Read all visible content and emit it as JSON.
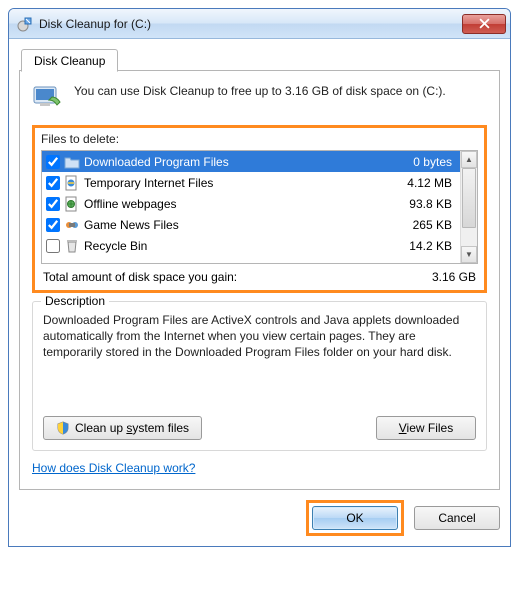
{
  "window": {
    "title": "Disk Cleanup for  (C:)"
  },
  "tab": {
    "label": "Disk Cleanup"
  },
  "intro": "You can use Disk Cleanup to free up to 3.16 GB of disk space on  (C:).",
  "files_label": "Files to delete:",
  "rows": [
    {
      "checked": true,
      "name": "Downloaded Program Files",
      "size": "0 bytes",
      "icon": "folder-download"
    },
    {
      "checked": true,
      "name": "Temporary Internet Files",
      "size": "4.12 MB",
      "icon": "ie-file"
    },
    {
      "checked": true,
      "name": "Offline webpages",
      "size": "93.8 KB",
      "icon": "globe-doc"
    },
    {
      "checked": true,
      "name": "Game News Files",
      "size": "265 KB",
      "icon": "game"
    },
    {
      "checked": false,
      "name": "Recycle Bin",
      "size": "14.2 KB",
      "icon": "recycle"
    }
  ],
  "total": {
    "label": "Total amount of disk space you gain:",
    "value": "3.16 GB"
  },
  "description": {
    "legend": "Description",
    "text": "Downloaded Program Files are ActiveX controls and Java applets downloaded automatically from the Internet when you view certain pages. They are temporarily stored in the Downloaded Program Files folder on your hard disk."
  },
  "buttons": {
    "cleanup_system": "Clean up system files",
    "view_files": "View Files",
    "ok": "OK",
    "cancel": "Cancel"
  },
  "help_link": "How does Disk Cleanup work?"
}
